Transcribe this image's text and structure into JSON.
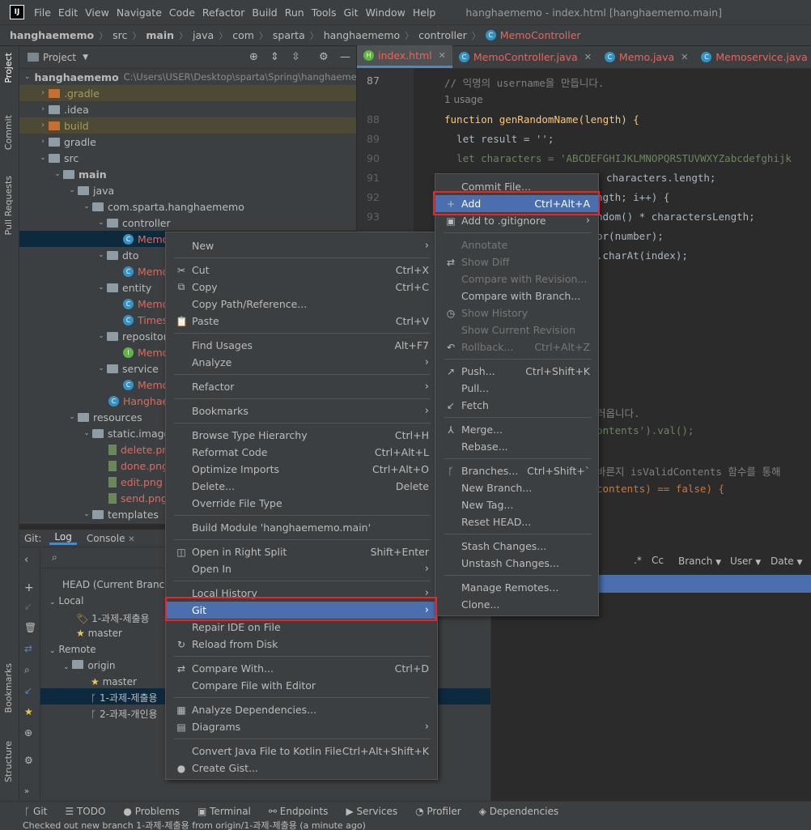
{
  "menubar": {
    "logo": "IJ",
    "items": [
      "File",
      "Edit",
      "View",
      "Navigate",
      "Code",
      "Refactor",
      "Build",
      "Run",
      "Tools",
      "Git",
      "Window",
      "Help"
    ],
    "window_title": "hanghaememo - index.html [hanghaememo.main]"
  },
  "breadcrumb": [
    "hanghaememo",
    "src",
    "main",
    "java",
    "com",
    "sparta",
    "hanghaememo",
    "controller",
    "MemoController"
  ],
  "left_strip": {
    "project": "Project",
    "commit": "Commit",
    "pull_requests": "Pull Requests",
    "bookmarks": "Bookmarks",
    "structure": "Structure"
  },
  "project": {
    "header": "Project",
    "tree": [
      {
        "label": "hanghaememo",
        "extra": "C:\\Users\\USER\\Desktop\\sparta\\Spring\\hanghaememo",
        "kind": "root"
      },
      {
        "label": ".gradle",
        "kind": "folder-o"
      },
      {
        "label": ".idea",
        "kind": "folder"
      },
      {
        "label": "build",
        "kind": "folder-o"
      },
      {
        "label": "gradle",
        "kind": "folder"
      },
      {
        "label": "src",
        "kind": "folder"
      },
      {
        "label": "main",
        "kind": "folder"
      },
      {
        "label": "java",
        "kind": "folder"
      },
      {
        "label": "com.sparta.hanghaememo",
        "kind": "pkg"
      },
      {
        "label": "controller",
        "kind": "pkg"
      },
      {
        "label": "Memo",
        "kind": "class"
      },
      {
        "label": "dto",
        "kind": "pkg"
      },
      {
        "label": "Memo",
        "kind": "class"
      },
      {
        "label": "entity",
        "kind": "pkg"
      },
      {
        "label": "Memo",
        "kind": "class"
      },
      {
        "label": "Times",
        "kind": "class"
      },
      {
        "label": "repository",
        "kind": "pkg"
      },
      {
        "label": "Memo",
        "kind": "iface"
      },
      {
        "label": "service",
        "kind": "pkg"
      },
      {
        "label": "Memo",
        "kind": "class"
      },
      {
        "label": "Hanghae",
        "kind": "app"
      },
      {
        "label": "resources",
        "kind": "folder"
      },
      {
        "label": "static.images",
        "kind": "pkg"
      },
      {
        "label": "delete.png",
        "kind": "img"
      },
      {
        "label": "done.png",
        "kind": "img"
      },
      {
        "label": "edit.png",
        "kind": "img"
      },
      {
        "label": "send.png",
        "kind": "img"
      },
      {
        "label": "templates",
        "kind": "folder"
      }
    ]
  },
  "tabs": [
    "index.html",
    "MemoController.java",
    "Memo.java",
    "Memoservice.java"
  ],
  "editor": {
    "lines": [
      {
        "n": "87",
        "t": "// 익명의 username을 만듭니다."
      },
      {
        "n": "",
        "t": "1 usage"
      },
      {
        "n": "88",
        "t": "function genRandomName(length) {"
      },
      {
        "n": "89",
        "t": "  let result = '';"
      },
      {
        "n": "90",
        "t": "  let characters = 'ABCDEFGHIJKLMNOPQRSTUVWXYZabcdefghijk"
      },
      {
        "n": "91",
        "t": "characters.length;"
      },
      {
        "n": "92",
        "t": "ngth; i++) {"
      },
      {
        "n": "93",
        "t": "ndom() * charactersLength;"
      },
      {
        "n": "",
        "t": "or(number);"
      },
      {
        "n": "",
        "t": ".charAt(index);"
      },
      {
        "n": "",
        "t": "러옵니다."
      },
      {
        "n": "",
        "t": "ontents').val();"
      },
      {
        "n": "",
        "t": "바른지 isValidContents 함수를 통해"
      },
      {
        "n": "",
        "t": "contents) == false) {"
      }
    ]
  },
  "git_panel": {
    "tabs": {
      "git": "Git:",
      "log": "Log",
      "console": "Console"
    },
    "branches": {
      "head": "HEAD (Current Branch)",
      "local": "Local",
      "local_items": [
        "1-과제-제출용",
        "master"
      ],
      "remote": "Remote",
      "origin": "origin",
      "remote_items": [
        "master",
        "1-과제-제출용",
        "2-과제-개인용"
      ]
    },
    "filters": {
      "branch": "Branch",
      "user": "User",
      "date": "Date"
    }
  },
  "context_menu": [
    {
      "label": "New",
      "sub": true
    },
    {
      "sep": true
    },
    {
      "label": "Cut",
      "sc": "Ctrl+X",
      "icon": "✂"
    },
    {
      "label": "Copy",
      "sc": "Ctrl+C",
      "icon": "⧉"
    },
    {
      "label": "Copy Path/Reference..."
    },
    {
      "label": "Paste",
      "sc": "Ctrl+V",
      "icon": "📋"
    },
    {
      "sep": true
    },
    {
      "label": "Find Usages",
      "sc": "Alt+F7"
    },
    {
      "label": "Analyze",
      "sub": true
    },
    {
      "sep": true
    },
    {
      "label": "Refactor",
      "sub": true
    },
    {
      "sep": true
    },
    {
      "label": "Bookmarks",
      "sub": true
    },
    {
      "sep": true
    },
    {
      "label": "Browse Type Hierarchy",
      "sc": "Ctrl+H"
    },
    {
      "label": "Reformat Code",
      "sc": "Ctrl+Alt+L"
    },
    {
      "label": "Optimize Imports",
      "sc": "Ctrl+Alt+O"
    },
    {
      "label": "Delete...",
      "sc": "Delete"
    },
    {
      "label": "Override File Type"
    },
    {
      "sep": true
    },
    {
      "label": "Build Module 'hanghaememo.main'"
    },
    {
      "sep": true
    },
    {
      "label": "Open in Right Split",
      "sc": "Shift+Enter",
      "icon": "◫"
    },
    {
      "label": "Open In",
      "sub": true
    },
    {
      "sep": true
    },
    {
      "label": "Local History",
      "sub": true
    },
    {
      "label": "Git",
      "sub": true,
      "sel": true
    },
    {
      "label": "Repair IDE on File"
    },
    {
      "label": "Reload from Disk",
      "icon": "↻"
    },
    {
      "sep": true
    },
    {
      "label": "Compare With...",
      "sc": "Ctrl+D",
      "icon": "⇄"
    },
    {
      "label": "Compare File with Editor"
    },
    {
      "sep": true
    },
    {
      "label": "Analyze Dependencies...",
      "icon": "▦"
    },
    {
      "label": "Diagrams",
      "sub": true,
      "icon": "▤"
    },
    {
      "sep": true
    },
    {
      "label": "Convert Java File to Kotlin File",
      "sc": "Ctrl+Alt+Shift+K"
    },
    {
      "label": "Create Gist...",
      "icon": "●"
    }
  ],
  "git_submenu": [
    {
      "label": "Commit File..."
    },
    {
      "label": "Add",
      "sc": "Ctrl+Alt+A",
      "icon": "+",
      "sel": true
    },
    {
      "label": "Add to .gitignore",
      "sub": true,
      "icon": "▣"
    },
    {
      "sep": true
    },
    {
      "label": "Annotate",
      "dis": true
    },
    {
      "label": "Show Diff",
      "dis": true,
      "icon": "⇄"
    },
    {
      "label": "Compare with Revision...",
      "dis": true
    },
    {
      "label": "Compare with Branch..."
    },
    {
      "label": "Show History",
      "dis": true,
      "icon": "◷"
    },
    {
      "label": "Show Current Revision",
      "dis": true
    },
    {
      "label": "Rollback...",
      "sc": "Ctrl+Alt+Z",
      "dis": true,
      "icon": "↶"
    },
    {
      "sep": true
    },
    {
      "label": "Push...",
      "sc": "Ctrl+Shift+K",
      "icon": "↗"
    },
    {
      "label": "Pull..."
    },
    {
      "label": "Fetch",
      "icon": "↙"
    },
    {
      "sep": true
    },
    {
      "label": "Merge...",
      "icon": "⅄"
    },
    {
      "label": "Rebase..."
    },
    {
      "sep": true
    },
    {
      "label": "Branches...",
      "sc": "Ctrl+Shift+`",
      "icon": "ᚴ"
    },
    {
      "label": "New Branch..."
    },
    {
      "label": "New Tag..."
    },
    {
      "label": "Reset HEAD..."
    },
    {
      "sep": true
    },
    {
      "label": "Stash Changes..."
    },
    {
      "label": "Unstash Changes..."
    },
    {
      "sep": true
    },
    {
      "label": "Manage Remotes..."
    },
    {
      "label": "Clone..."
    }
  ],
  "bottom_tabs": [
    "Git",
    "TODO",
    "Problems",
    "Terminal",
    "Endpoints",
    "Services",
    "Profiler",
    "Dependencies"
  ],
  "status": "Checked out new branch 1-과제-제출용 from origin/1-과제-제출용 (a minute ago)"
}
